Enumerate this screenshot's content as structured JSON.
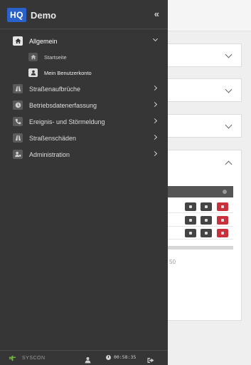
{
  "brand": {
    "logo": "HQ",
    "name": "Demo",
    "collapse": "«"
  },
  "nav": {
    "allgemein": {
      "label": "Allgemein",
      "icon": "home-icon"
    },
    "startseite": {
      "label": "Startseite",
      "icon": "home-icon"
    },
    "benutzerkonto": {
      "label": "Mein Benutzerkonto",
      "icon": "user-icon"
    },
    "strassenaufbrueche": {
      "label": "Straßenaufbrüche",
      "icon": "road-icon"
    },
    "betriebsdaten": {
      "label": "Betriebsdatenerfassung",
      "icon": "clock-icon"
    },
    "ereignis": {
      "label": "Ereignis- und Störmeldung",
      "icon": "phone-icon"
    },
    "strassenschaeden": {
      "label": "Straßenschäden",
      "icon": "road-icon"
    },
    "administration": {
      "label": "Administration",
      "icon": "users-cog-icon"
    }
  },
  "footer": {
    "company": "SYSCON",
    "session_time": "00:58:35"
  },
  "background": {
    "number_fragment": "50"
  },
  "colors": {
    "drawer": "#363636",
    "brand_blue": "#2a62c9",
    "danger_red": "#c8303b"
  }
}
